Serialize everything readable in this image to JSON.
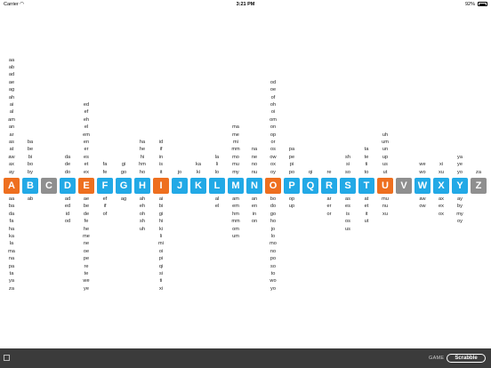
{
  "status_bar": {
    "carrier": "Carrier",
    "time": "3:21 PM",
    "battery": "92%"
  },
  "colors": {
    "orange": "#ee6f1f",
    "blue": "#22a9e6",
    "gray": "#8f8f8f"
  },
  "columns": [
    {
      "letter": "A",
      "color": "orange",
      "above": [
        "aa",
        "ab",
        "ad",
        "ae",
        "ag",
        "ah",
        "ai",
        "al",
        "am",
        "an",
        "ar",
        "as",
        "at",
        "aw",
        "ax",
        "ay"
      ],
      "below": [
        "aa",
        "ba",
        "da",
        "fa",
        "ha",
        "ka",
        "la",
        "ma",
        "na",
        "pa",
        "ta",
        "ya",
        "za"
      ]
    },
    {
      "letter": "B",
      "color": "blue",
      "above": [
        "ba",
        "be",
        "bi",
        "bo",
        "by"
      ],
      "below": [
        "ab"
      ]
    },
    {
      "letter": "C",
      "color": "gray",
      "above": [],
      "below": []
    },
    {
      "letter": "D",
      "color": "blue",
      "above": [
        "da",
        "de",
        "do"
      ],
      "below": [
        "ad",
        "ed",
        "id",
        "od"
      ]
    },
    {
      "letter": "E",
      "color": "orange",
      "above": [
        "ed",
        "ef",
        "eh",
        "el",
        "em",
        "en",
        "er",
        "es",
        "et",
        "ex"
      ],
      "below": [
        "ae",
        "be",
        "de",
        "fe",
        "he",
        "me",
        "ne",
        "oe",
        "pe",
        "re",
        "te",
        "we",
        "ye"
      ]
    },
    {
      "letter": "F",
      "color": "blue",
      "above": [
        "fa",
        "fe"
      ],
      "below": [
        "ef",
        "if",
        "of"
      ]
    },
    {
      "letter": "G",
      "color": "blue",
      "above": [
        "gi",
        "go"
      ],
      "below": [
        "ag"
      ]
    },
    {
      "letter": "H",
      "color": "blue",
      "above": [
        "ha",
        "he",
        "hi",
        "hm",
        "ho"
      ],
      "below": [
        "ah",
        "eh",
        "oh",
        "sh",
        "uh"
      ]
    },
    {
      "letter": "I",
      "color": "orange",
      "above": [
        "id",
        "if",
        "in",
        "is",
        "it"
      ],
      "below": [
        "ai",
        "bi",
        "gi",
        "hi",
        "ki",
        "li",
        "mi",
        "oi",
        "pi",
        "qi",
        "si",
        "ti",
        "xi"
      ]
    },
    {
      "letter": "J",
      "color": "blue",
      "above": [
        "jo"
      ],
      "below": []
    },
    {
      "letter": "K",
      "color": "blue",
      "above": [
        "ka",
        "ki"
      ],
      "below": []
    },
    {
      "letter": "L",
      "color": "blue",
      "above": [
        "la",
        "li",
        "lo"
      ],
      "below": [
        "al",
        "el"
      ]
    },
    {
      "letter": "M",
      "color": "blue",
      "above": [
        "ma",
        "me",
        "mi",
        "mm",
        "mo",
        "mu",
        "my"
      ],
      "below": [
        "am",
        "em",
        "hm",
        "mm",
        "om",
        "um"
      ]
    },
    {
      "letter": "N",
      "color": "blue",
      "above": [
        "na",
        "ne",
        "no",
        "nu"
      ],
      "below": [
        "an",
        "en",
        "in",
        "on"
      ]
    },
    {
      "letter": "O",
      "color": "orange",
      "above": [
        "od",
        "oe",
        "of",
        "oh",
        "oi",
        "om",
        "on",
        "op",
        "or",
        "os",
        "ow",
        "ox",
        "oy"
      ],
      "below": [
        "bo",
        "do",
        "go",
        "ho",
        "jo",
        "lo",
        "mo",
        "no",
        "po",
        "so",
        "to",
        "wo",
        "yo"
      ]
    },
    {
      "letter": "P",
      "color": "blue",
      "above": [
        "pa",
        "pe",
        "pi",
        "po"
      ],
      "below": [
        "op",
        "up"
      ]
    },
    {
      "letter": "Q",
      "color": "blue",
      "above": [
        "qi"
      ],
      "below": []
    },
    {
      "letter": "R",
      "color": "blue",
      "above": [
        "re"
      ],
      "below": [
        "ar",
        "er",
        "or"
      ]
    },
    {
      "letter": "S",
      "color": "blue",
      "above": [
        "sh",
        "si",
        "so"
      ],
      "below": [
        "as",
        "es",
        "is",
        "os",
        "us"
      ]
    },
    {
      "letter": "T",
      "color": "blue",
      "above": [
        "ta",
        "te",
        "ti",
        "to"
      ],
      "below": [
        "at",
        "et",
        "it",
        "ut"
      ]
    },
    {
      "letter": "U",
      "color": "orange",
      "above": [
        "uh",
        "um",
        "un",
        "up",
        "us",
        "ut"
      ],
      "below": [
        "mu",
        "nu",
        "xu"
      ]
    },
    {
      "letter": "V",
      "color": "gray",
      "above": [],
      "below": []
    },
    {
      "letter": "W",
      "color": "blue",
      "above": [
        "we",
        "wo"
      ],
      "below": [
        "aw",
        "ow"
      ]
    },
    {
      "letter": "X",
      "color": "blue",
      "above": [
        "xi",
        "xu"
      ],
      "below": [
        "ax",
        "ex",
        "ox"
      ]
    },
    {
      "letter": "Y",
      "color": "blue",
      "above": [
        "ya",
        "ye",
        "yo"
      ],
      "below": [
        "ay",
        "by",
        "my",
        "oy"
      ]
    },
    {
      "letter": "Z",
      "color": "gray",
      "above": [
        "za"
      ],
      "below": []
    }
  ],
  "footer": {
    "game_label": "GAME",
    "game_button": "Scrabble"
  }
}
